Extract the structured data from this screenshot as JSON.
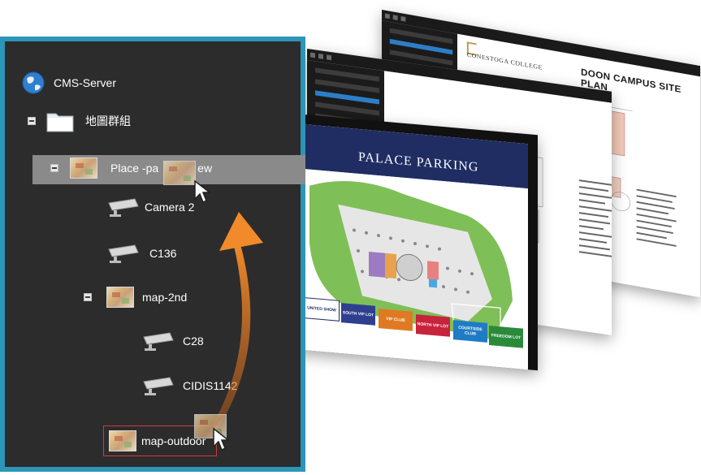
{
  "tree": {
    "server_label": "CMS-Server",
    "group_label": "地圖群組",
    "selected_map_label": "Place -pa",
    "selected_map_label_tail": "ew",
    "cameras_level1": [
      "Camera 2",
      "C136"
    ],
    "submap_label": "map-2nd",
    "cameras_level2": [
      "C28",
      "CIDIS1142"
    ],
    "drop_map_label": "map-outdoor"
  },
  "windows": {
    "back": {
      "title": "DOON CAMPUS SITE PLAN",
      "org": "CONESTOGA COLLEGE"
    },
    "front": {
      "title": "PALACE PARKING",
      "legend": [
        "UNITED SHOW",
        "SOUTH VIP LOT",
        "VIP CLUB",
        "NORTH VIP LOT",
        "COURTSIDE CLUB",
        "FREEDOM LOT"
      ]
    }
  },
  "colors": {
    "panel_bg": "#2c2c2c",
    "panel_border": "#2c95b8",
    "selected_row": "#8a8a8a",
    "drop_outline": "#d23a3a",
    "drag_arrow": "#e8842c",
    "legend": [
      "#ffffff",
      "#2f3f8f",
      "#e07a22",
      "#c8233c",
      "#1f7cc4",
      "#2a8a3a"
    ]
  },
  "icons": {
    "server": "globe-icon",
    "group": "folder-icon",
    "map": "map-thumbnail-icon",
    "camera": "camera-icon",
    "cursor": "cursor-arrow-icon"
  }
}
